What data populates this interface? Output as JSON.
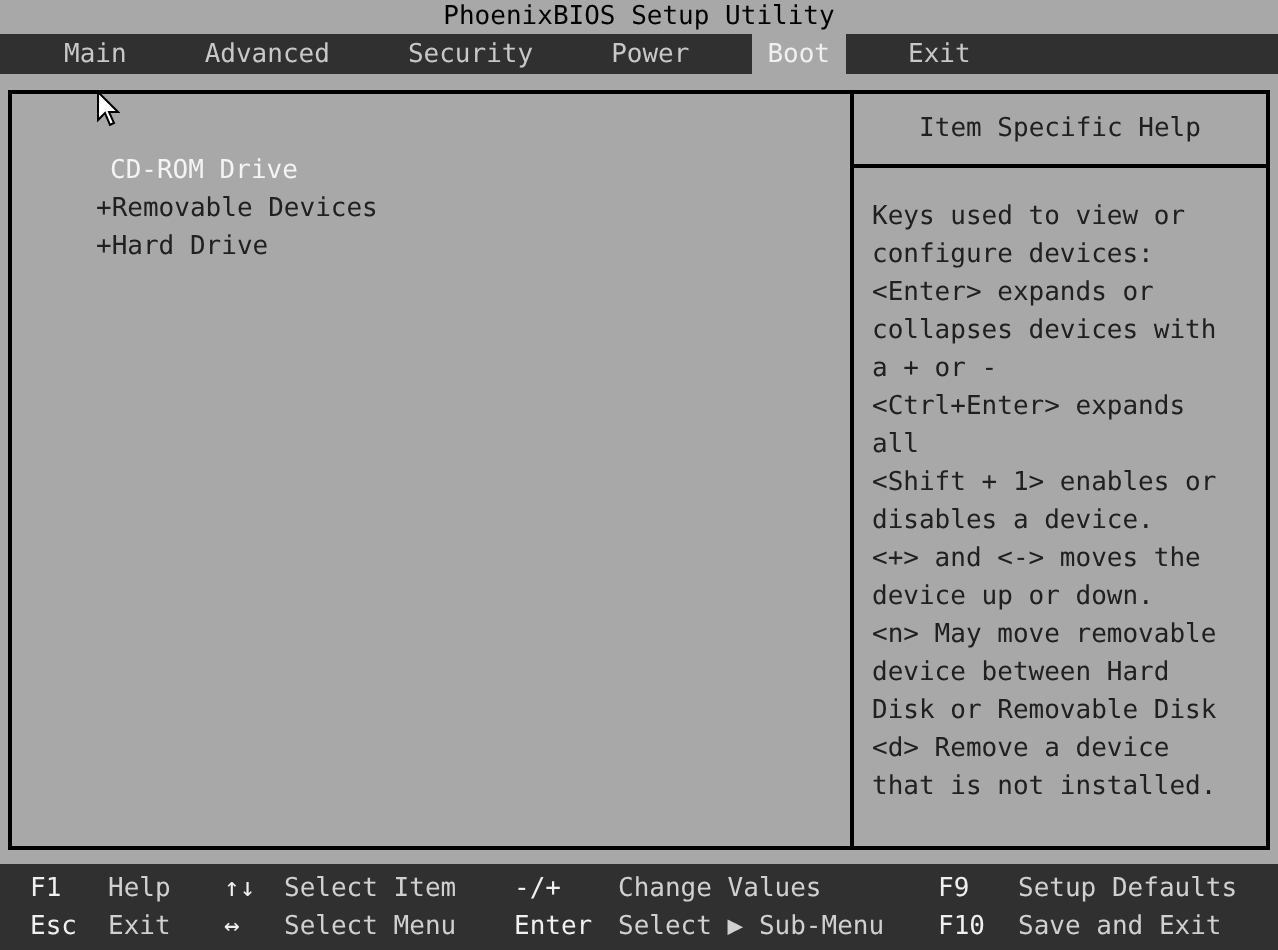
{
  "window": {
    "title": "PhoenixBIOS Setup Utility"
  },
  "tabs": [
    {
      "label": "Main",
      "selected": false
    },
    {
      "label": "Advanced",
      "selected": false
    },
    {
      "label": "Security",
      "selected": false
    },
    {
      "label": "Power",
      "selected": false
    },
    {
      "label": "Boot",
      "selected": true
    },
    {
      "label": "Exit",
      "selected": false
    }
  ],
  "boot_items": [
    {
      "label": "CD-ROM Drive",
      "kind": "device",
      "selected": true
    },
    {
      "label": "+Removable Devices",
      "kind": "group",
      "selected": false
    },
    {
      "label": "+Hard Drive",
      "kind": "group",
      "selected": false
    }
  ],
  "help": {
    "title": "Item Specific Help",
    "lines": [
      "Keys used to view or",
      "configure devices:",
      "<Enter> expands or",
      "collapses devices with",
      "a + or -",
      "<Ctrl+Enter> expands",
      "all",
      "<Shift + 1> enables or",
      "disables a device.",
      "<+> and <-> moves the",
      "device up or down.",
      "<n> May move removable",
      "device between Hard",
      "Disk or Removable Disk",
      "<d> Remove a device",
      "that is not installed."
    ]
  },
  "key_legend": [
    [
      {
        "key": "F1",
        "action": "Help"
      },
      {
        "key": "↑↓",
        "action": "Select Item"
      },
      {
        "key": "-/+",
        "action": "Change Values"
      },
      {
        "key": "F9",
        "action": "Setup Defaults"
      }
    ],
    [
      {
        "key": "Esc",
        "action": "Exit"
      },
      {
        "key": "↔",
        "action": "Select Menu"
      },
      {
        "key": "Enter",
        "action": "Select ▶ Sub-Menu"
      },
      {
        "key": "F10",
        "action": "Save and Exit"
      }
    ]
  ]
}
